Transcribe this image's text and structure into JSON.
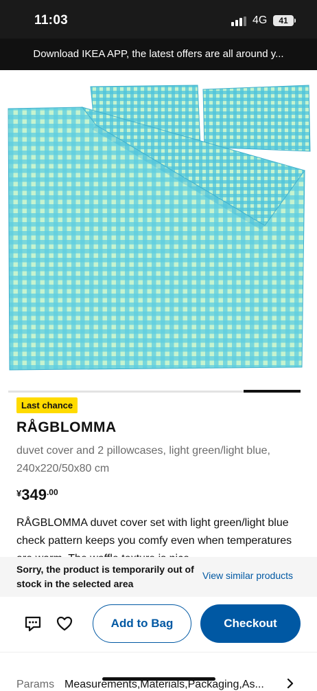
{
  "status_bar": {
    "time": "11:03",
    "network": "4G",
    "battery": "41"
  },
  "banner": {
    "text": "Download IKEA APP, the latest offers are all around y..."
  },
  "product": {
    "badge": "Last chance",
    "name": "RÅGBLOMMA",
    "subtitle": "duvet cover and 2 pillowcases, light green/light blue, 240x220/50x80 cm",
    "price_currency": "¥",
    "price_integer": "349",
    "price_decimal": ".00",
    "description": "RÅGBLOMMA duvet cover set with light green/light blue check pattern keeps you comfy even when temperatures are warm. The waffle texture is nice",
    "image_colors": {
      "blue": "#3fb8d6",
      "green": "#9fe9a8"
    }
  },
  "stock_notice": {
    "message": "Sorry, the product is temporarily out of stock in the selected area",
    "link": "View similar products"
  },
  "actions": {
    "chat_icon": "chat-icon",
    "favorite_icon": "heart-icon",
    "add_to_bag": "Add to Bag",
    "checkout": "Checkout"
  },
  "params": {
    "label": "Params",
    "value": "Measurements,Materials,Packaging,As..."
  },
  "colors": {
    "brand_blue": "#0058a3",
    "badge_yellow": "#ffdb00"
  }
}
